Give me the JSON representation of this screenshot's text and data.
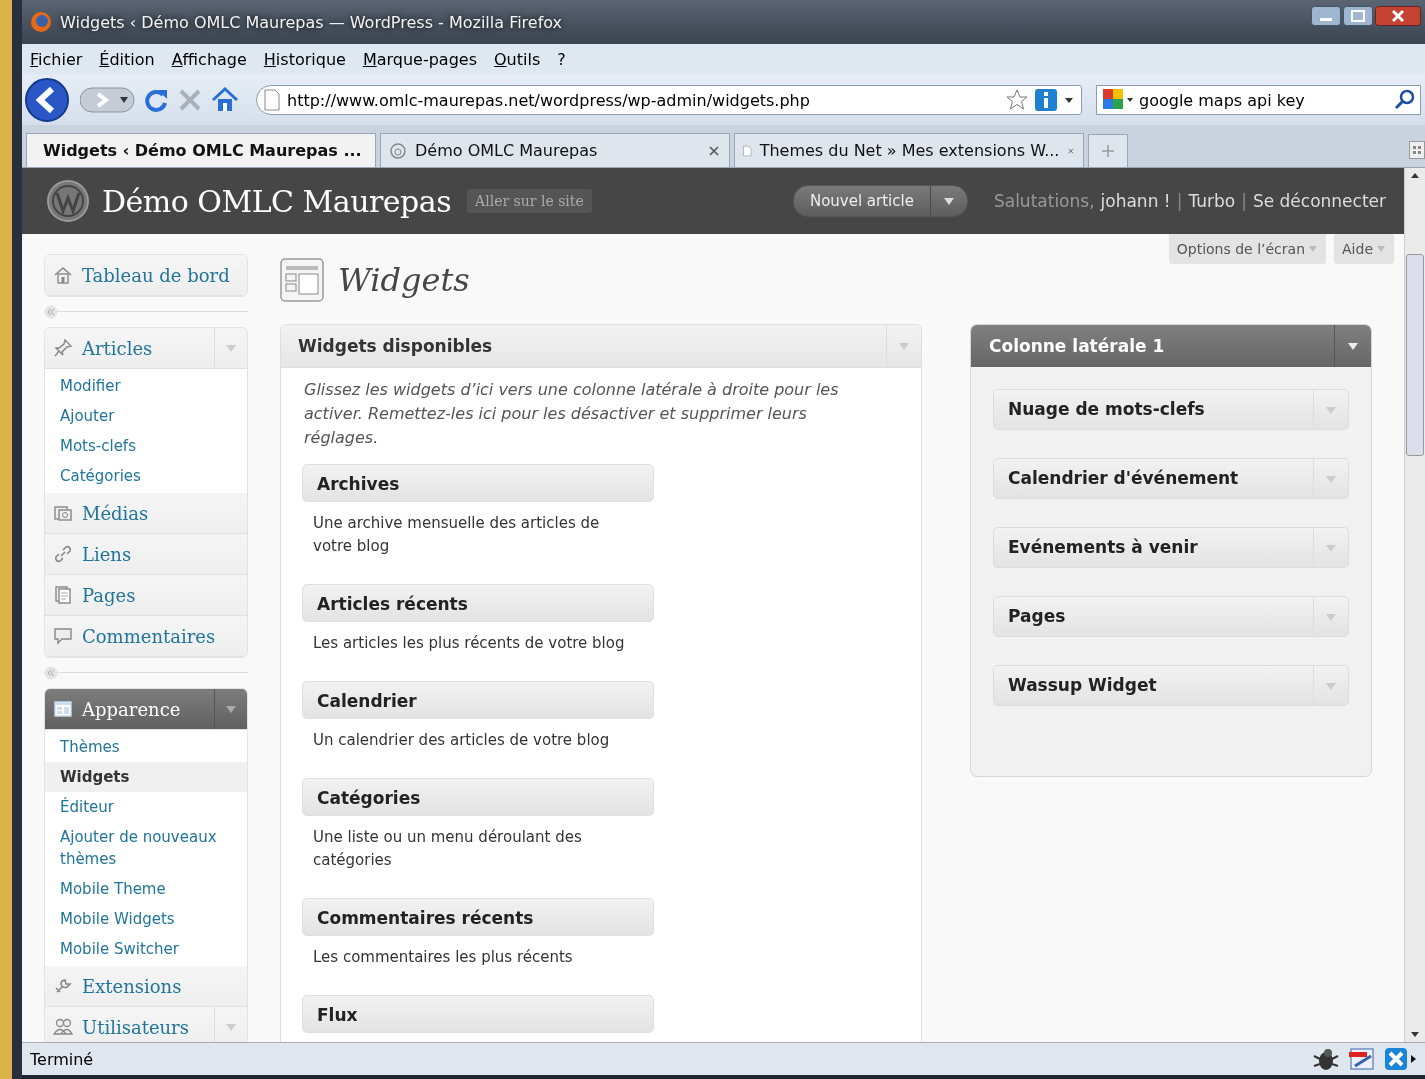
{
  "window": {
    "title": "Widgets ‹ Démo OMLC Maurepas — WordPress - Mozilla Firefox"
  },
  "menu_bar": [
    "Fichier",
    "Édition",
    "Affichage",
    "Historique",
    "Marque-pages",
    "Outils",
    "?"
  ],
  "address_bar": {
    "value": "http://www.omlc-maurepas.net/wordpress/wp-admin/widgets.php"
  },
  "search_bar": {
    "value": "google maps api key"
  },
  "tabs": [
    {
      "label": "Widgets ‹ Démo OMLC Maurepas ...",
      "selected": true
    },
    {
      "label": "Démo OMLC Maurepas",
      "selected": false
    },
    {
      "label": "Themes du Net » Mes extensions W...",
      "selected": false
    }
  ],
  "header": {
    "site_title": "Démo OMLC Maurepas",
    "visit_site": "Aller sur le site",
    "new_post": "Nouvel article",
    "greeting": "Salutations,",
    "user": "johann !",
    "separator_1": "|",
    "turbo": "Turbo",
    "separator_2": "|",
    "logout": "Se déconnecter"
  },
  "screen_options": "Options de l’écran",
  "help": "Aide",
  "sidebar": {
    "groups": [
      [
        {
          "label": "Tableau de bord",
          "toggle": false,
          "current": false
        }
      ],
      [
        {
          "label": "Articles",
          "toggle": true,
          "current": false,
          "children": [
            {
              "label": "Modifier",
              "selected": false
            },
            {
              "label": "Ajouter",
              "selected": false
            },
            {
              "label": "Mots-clefs",
              "selected": false
            },
            {
              "label": "Catégories",
              "selected": false
            }
          ]
        },
        {
          "label": "Médias",
          "toggle": false,
          "current": false
        },
        {
          "label": "Liens",
          "toggle": false,
          "current": false
        },
        {
          "label": "Pages",
          "toggle": false,
          "current": false
        },
        {
          "label": "Commentaires",
          "toggle": false,
          "current": false
        }
      ],
      [
        {
          "label": "Apparence",
          "toggle": true,
          "current": true,
          "children": [
            {
              "label": "Thèmes",
              "selected": false
            },
            {
              "label": "Widgets",
              "selected": true
            },
            {
              "label": "Éditeur",
              "selected": false
            },
            {
              "label": "Ajouter de nouveaux thèmes",
              "selected": false
            },
            {
              "label": "Mobile Theme",
              "selected": false
            },
            {
              "label": "Mobile Widgets",
              "selected": false
            },
            {
              "label": "Mobile Switcher",
              "selected": false
            }
          ]
        },
        {
          "label": "Extensions",
          "toggle": false,
          "current": false
        },
        {
          "label": "Utilisateurs",
          "toggle": true,
          "current": false
        }
      ]
    ]
  },
  "page_title": "Widgets",
  "available": {
    "title": "Widgets disponibles",
    "description": "Glissez les widgets d’ici vers une colonne latérale à droite pour les activer. Remettez-les ici pour les désactiver et supprimer leurs réglages.",
    "widgets": [
      {
        "title": "Archives",
        "description": "Une archive mensuelle des articles de votre blog"
      },
      {
        "title": "Articles récents",
        "description": "Les articles les plus récents de votre blog"
      },
      {
        "title": "Calendrier",
        "description": "Un calendrier des articles de votre blog"
      },
      {
        "title": "Catégories",
        "description": "Une liste ou un menu déroulant des catégories"
      },
      {
        "title": "Commentaires récents",
        "description": "Les commentaires les plus récents"
      },
      {
        "title": "Flux"
      }
    ]
  },
  "sidebar_area": {
    "title": "Colonne latérale 1",
    "widgets": [
      "Nuage de mots-clefs",
      "Calendrier d'événement",
      "Evénements à venir",
      "Pages",
      "Wassup Widget"
    ]
  },
  "status_bar": {
    "text": "Terminé"
  }
}
